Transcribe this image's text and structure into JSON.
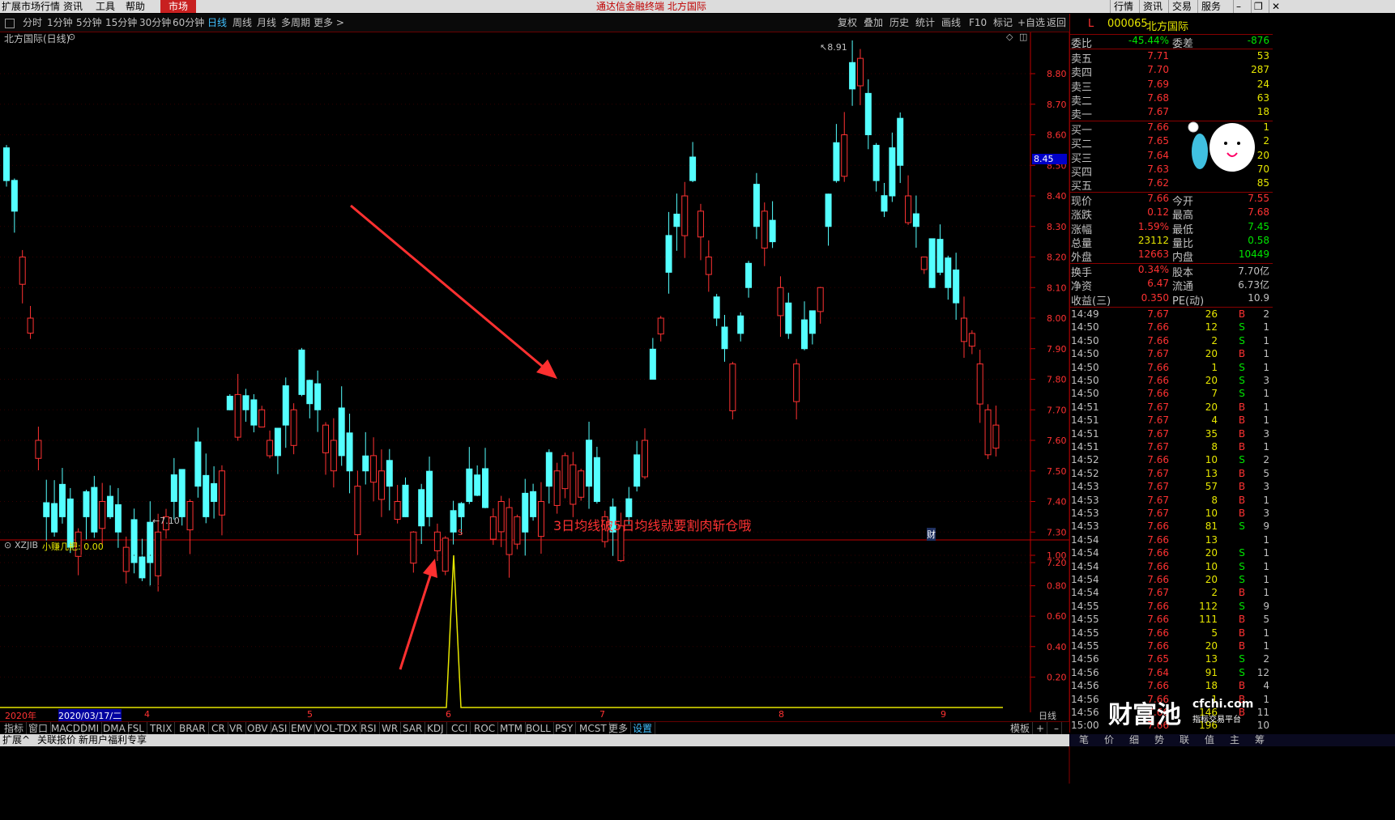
{
  "menu": {
    "items": [
      "扩展市场行情",
      "资讯",
      "工具",
      "帮助"
    ],
    "market": "市场",
    "title": "通达信金融终端  北方国际",
    "right": [
      "行情",
      "资讯",
      "交易",
      "服务"
    ]
  },
  "periods": [
    "分时",
    "1分钟",
    "5分钟",
    "15分钟",
    "30分钟",
    "60分钟",
    "日线",
    "周线",
    "月线",
    "多周期",
    "更多 >"
  ],
  "active_period": "日线",
  "tools": [
    "复权",
    "叠加",
    "历史",
    "统计",
    "画线",
    "F10",
    "标记",
    "+自选",
    "返回"
  ],
  "main_chart": {
    "title": "北方国际(日线)",
    "y_ticks": [
      "8.80",
      "8.70",
      "8.60",
      "8.50",
      "8.40",
      "8.30",
      "8.20",
      "8.10",
      "8.00",
      "7.90",
      "7.80",
      "7.70",
      "7.60",
      "7.50",
      "7.40",
      "7.30",
      "7.20"
    ],
    "current_price_tag": "8.45",
    "high_label": "8.91",
    "low_label": "7.10",
    "annotation": "3日均线破5日均线就要割肉斩仓哦",
    "signal_marker": "S",
    "cai_marker": "财",
    "colors": {
      "up": "#ff3232",
      "down": "#54ffff",
      "axis": "#c00000"
    }
  },
  "indicator": {
    "name": "XZJIB",
    "line_label": "小赚几把: 0.00",
    "y_ticks": [
      "1.00",
      "0.80",
      "0.60",
      "0.40",
      "0.20"
    ],
    "line_color": "#e6e600"
  },
  "date_axis": {
    "year": "2020年",
    "cursor_date": "2020/03/17/二",
    "months": [
      "4",
      "5",
      "6",
      "7",
      "8",
      "9"
    ],
    "right_label": "日线"
  },
  "indicator_tabs": [
    "指标",
    "窗口",
    "MACD",
    "DMI",
    "DMA",
    "FSL",
    "TRIX",
    "BRAR",
    "CR",
    "VR",
    "OBV",
    "ASI",
    "EMV",
    "VOL-TDX",
    "RSI",
    "WR",
    "SAR",
    "KDJ",
    "CCI",
    "ROC",
    "MTM",
    "BOLL",
    "PSY",
    "MCST",
    "更多",
    "设置"
  ],
  "template_label": "模板",
  "status_items": [
    "扩展^",
    "关联报价",
    "新用户福利专享"
  ],
  "stock": {
    "code": "000065",
    "name": "北方国际",
    "flag": "L",
    "weibi_label": "委比",
    "weibi": "-45.44%",
    "weicha_label": "委差",
    "weicha": "-876",
    "asks": [
      {
        "label": "卖五",
        "price": "7.71",
        "vol": "53"
      },
      {
        "label": "卖四",
        "price": "7.70",
        "vol": "287"
      },
      {
        "label": "卖三",
        "price": "7.69",
        "vol": "24"
      },
      {
        "label": "卖二",
        "price": "7.68",
        "vol": "63"
      },
      {
        "label": "卖一",
        "price": "7.67",
        "vol": "18"
      }
    ],
    "bids": [
      {
        "label": "买一",
        "price": "7.66",
        "vol": "1"
      },
      {
        "label": "买二",
        "price": "7.65",
        "vol": "2"
      },
      {
        "label": "买三",
        "price": "7.64",
        "vol": "20"
      },
      {
        "label": "买四",
        "price": "7.63",
        "vol": "70"
      },
      {
        "label": "买五",
        "price": "7.62",
        "vol": "85"
      }
    ],
    "quote": [
      {
        "l1": "现价",
        "v1": "7.66",
        "l2": "今开",
        "v2": "7.55"
      },
      {
        "l1": "涨跌",
        "v1": "0.12",
        "l2": "最高",
        "v2": "7.68"
      },
      {
        "l1": "涨幅",
        "v1": "1.59%",
        "l2": "最低",
        "v2": "7.45"
      },
      {
        "l1": "总量",
        "v1": "23112",
        "l2": "量比",
        "v2": "0.58"
      },
      {
        "l1": "外盘",
        "v1": "12663",
        "l2": "内盘",
        "v2": "10449"
      }
    ],
    "fundamentals": [
      {
        "l1": "换手",
        "v1": "0.34%",
        "l2": "股本",
        "v2": "7.70亿"
      },
      {
        "l1": "净资",
        "v1": "6.47",
        "l2": "流通",
        "v2": "6.73亿"
      },
      {
        "l1": "收益(三)",
        "v1": "0.350",
        "l2": "PE(动)",
        "v2": "10.9"
      }
    ],
    "ticks": [
      {
        "t": "14:49",
        "p": "7.67",
        "v": "26",
        "bs": "B",
        "n": "2"
      },
      {
        "t": "14:50",
        "p": "7.66",
        "v": "12",
        "bs": "S",
        "n": "1"
      },
      {
        "t": "14:50",
        "p": "7.66",
        "v": "2",
        "bs": "S",
        "n": "1"
      },
      {
        "t": "14:50",
        "p": "7.67",
        "v": "20",
        "bs": "B",
        "n": "1"
      },
      {
        "t": "14:50",
        "p": "7.66",
        "v": "1",
        "bs": "S",
        "n": "1"
      },
      {
        "t": "14:50",
        "p": "7.66",
        "v": "20",
        "bs": "S",
        "n": "3"
      },
      {
        "t": "14:50",
        "p": "7.66",
        "v": "7",
        "bs": "S",
        "n": "1"
      },
      {
        "t": "14:51",
        "p": "7.67",
        "v": "20",
        "bs": "B",
        "n": "1"
      },
      {
        "t": "14:51",
        "p": "7.67",
        "v": "4",
        "bs": "B",
        "n": "1"
      },
      {
        "t": "14:51",
        "p": "7.67",
        "v": "35",
        "bs": "B",
        "n": "3"
      },
      {
        "t": "14:51",
        "p": "7.67",
        "v": "8",
        "bs": "B",
        "n": "1"
      },
      {
        "t": "14:52",
        "p": "7.66",
        "v": "10",
        "bs": "S",
        "n": "2"
      },
      {
        "t": "14:52",
        "p": "7.67",
        "v": "13",
        "bs": "B",
        "n": "5"
      },
      {
        "t": "14:53",
        "p": "7.67",
        "v": "57",
        "bs": "B",
        "n": "3"
      },
      {
        "t": "14:53",
        "p": "7.67",
        "v": "8",
        "bs": "B",
        "n": "1"
      },
      {
        "t": "14:53",
        "p": "7.67",
        "v": "10",
        "bs": "B",
        "n": "3"
      },
      {
        "t": "14:53",
        "p": "7.66",
        "v": "81",
        "bs": "S",
        "n": "9"
      },
      {
        "t": "14:54",
        "p": "7.66",
        "v": "13",
        "bs": "",
        "n": "1"
      },
      {
        "t": "14:54",
        "p": "7.66",
        "v": "20",
        "bs": "S",
        "n": "1"
      },
      {
        "t": "14:54",
        "p": "7.66",
        "v": "10",
        "bs": "S",
        "n": "1"
      },
      {
        "t": "14:54",
        "p": "7.66",
        "v": "20",
        "bs": "S",
        "n": "1"
      },
      {
        "t": "14:54",
        "p": "7.67",
        "v": "2",
        "bs": "B",
        "n": "1"
      },
      {
        "t": "14:55",
        "p": "7.66",
        "v": "112",
        "bs": "S",
        "n": "9"
      },
      {
        "t": "14:55",
        "p": "7.66",
        "v": "111",
        "bs": "B",
        "n": "5"
      },
      {
        "t": "14:55",
        "p": "7.66",
        "v": "5",
        "bs": "B",
        "n": "1"
      },
      {
        "t": "14:55",
        "p": "7.66",
        "v": "20",
        "bs": "B",
        "n": "1"
      },
      {
        "t": "14:56",
        "p": "7.65",
        "v": "13",
        "bs": "S",
        "n": "2"
      },
      {
        "t": "14:56",
        "p": "7.64",
        "v": "91",
        "bs": "S",
        "n": "12"
      },
      {
        "t": "14:56",
        "p": "7.66",
        "v": "18",
        "bs": "B",
        "n": "4"
      },
      {
        "t": "14:56",
        "p": "7.66",
        "v": "1",
        "bs": "B",
        "n": "1"
      },
      {
        "t": "14:56",
        "p": "7.66",
        "v": "146",
        "bs": "B",
        "n": "11"
      },
      {
        "t": "15:00",
        "p": "7.66",
        "v": "196",
        "bs": "",
        "n": "10"
      }
    ]
  },
  "watermark": {
    "brand": "财富池",
    "site": "cfchi.com",
    "sub": "指标交易平台"
  },
  "panel_tabs": [
    "笔",
    "价",
    "细",
    "势",
    "联",
    "值",
    "主",
    "筹"
  ]
}
